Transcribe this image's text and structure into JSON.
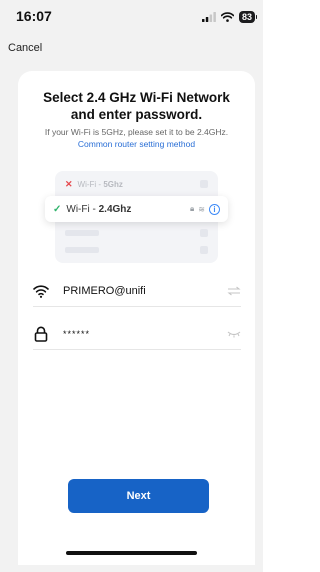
{
  "status_bar": {
    "time": "16:07",
    "battery": "83"
  },
  "nav": {
    "cancel_label": "Cancel"
  },
  "title": {
    "line1": "Select 2.4 GHz Wi-Fi Network",
    "line2": "and enter password."
  },
  "hint": "If your Wi-Fi is 5GHz, please set it to be 2.4GHz.",
  "router_link": "Common router setting method",
  "illustration": {
    "bad_prefix": "Wi-Fi - ",
    "bad_band": "5Ghz",
    "good_prefix": "Wi-Fi - ",
    "good_band": "2.4Ghz"
  },
  "form": {
    "ssid": "PRIMERO@unifi",
    "password_masked": "******"
  },
  "next_label": "Next",
  "colors": {
    "primary": "#1763c6",
    "link": "#2a6fd6",
    "check": "#2fb36b",
    "cross": "#e5484d"
  }
}
